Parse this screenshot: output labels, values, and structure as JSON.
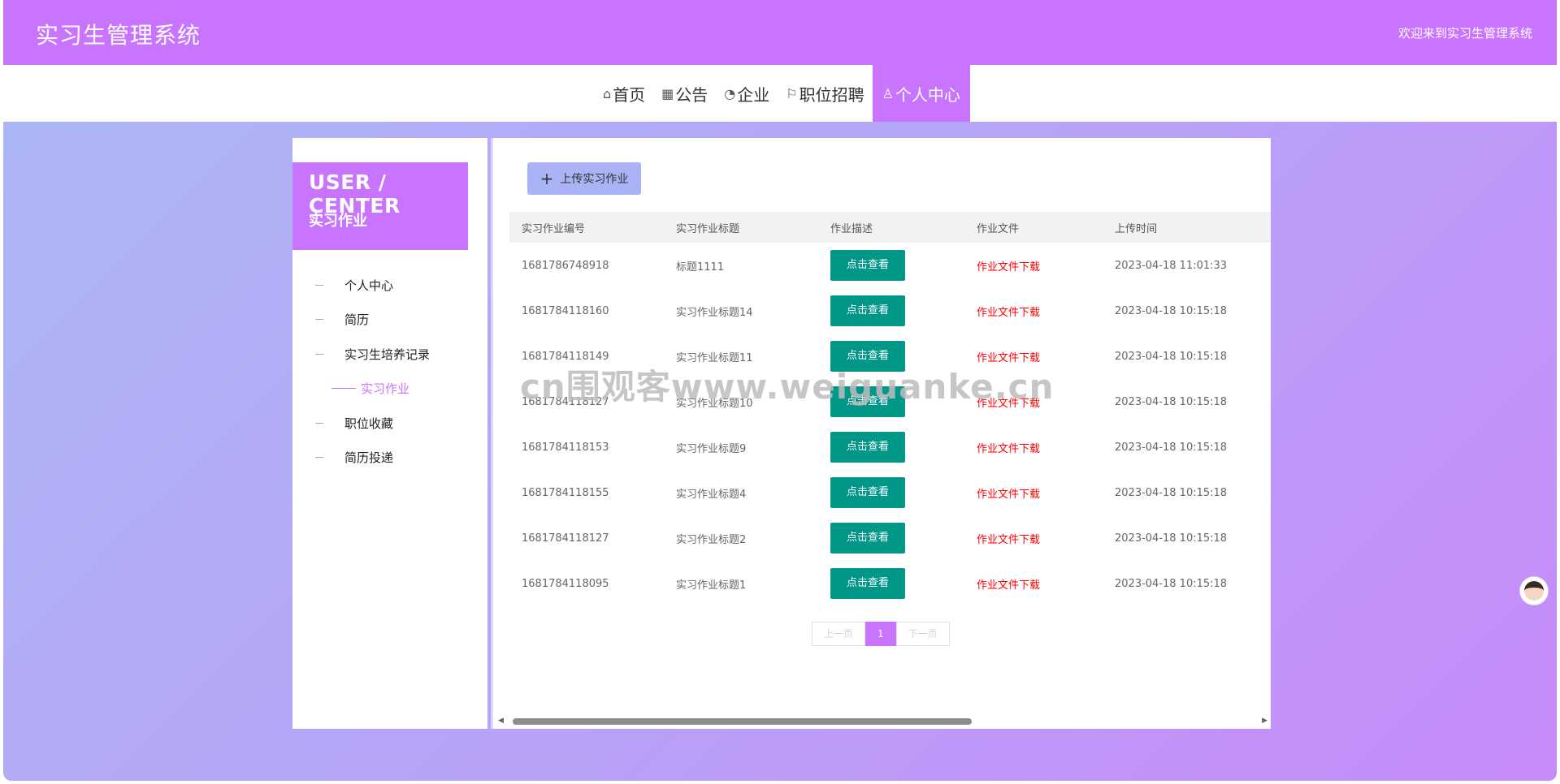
{
  "header": {
    "brand": "实习生管理系统",
    "welcome": "欢迎来到实习生管理系统"
  },
  "nav": {
    "items": [
      {
        "icon": "home-icon",
        "label": "首页"
      },
      {
        "icon": "notice-icon",
        "label": "公告"
      },
      {
        "icon": "gauge-icon",
        "label": "企业"
      },
      {
        "icon": "flag-icon",
        "label": "职位招聘"
      },
      {
        "icon": "user-icon",
        "label": "个人中心",
        "active": true
      }
    ]
  },
  "sidebar": {
    "title": "USER / CENTER",
    "subtitle": "实习作业",
    "items": [
      {
        "label": "个人中心"
      },
      {
        "label": "简历"
      },
      {
        "label": "实习生培养记录"
      },
      {
        "label": "实习作业",
        "active": true
      },
      {
        "label": "职位收藏"
      },
      {
        "label": "简历投递"
      }
    ]
  },
  "main": {
    "upload_label": "上传实习作业",
    "columns": [
      "实习作业编号",
      "实习作业标题",
      "作业描述",
      "作业文件",
      "上传时间"
    ],
    "view_label": "点击查看",
    "download_label": "作业文件下载",
    "rows": [
      {
        "id": "1681786748918",
        "title": "标题1111",
        "time": "2023-04-18 11:01:33"
      },
      {
        "id": "1681784118160",
        "title": "实习作业标题14",
        "time": "2023-04-18 10:15:18"
      },
      {
        "id": "1681784118149",
        "title": "实习作业标题11",
        "time": "2023-04-18 10:15:18"
      },
      {
        "id": "1681784118127",
        "title": "实习作业标题10",
        "time": "2023-04-18 10:15:18"
      },
      {
        "id": "1681784118153",
        "title": "实习作业标题9",
        "time": "2023-04-18 10:15:18"
      },
      {
        "id": "1681784118155",
        "title": "实习作业标题4",
        "time": "2023-04-18 10:15:18"
      },
      {
        "id": "1681784118127",
        "title": "实习作业标题2",
        "time": "2023-04-18 10:15:18"
      },
      {
        "id": "1681784118095",
        "title": "实习作业标题1",
        "time": "2023-04-18 10:15:18"
      }
    ],
    "pager": {
      "prev": "上一页",
      "current": "1",
      "next": "下一页"
    }
  },
  "watermark": "cn围观客www.weiguanke.cn",
  "colors": {
    "accent": "#c974fe",
    "view_button": "#009688",
    "download_link": "#ff0000",
    "upload_button": "#a9b3f5"
  }
}
